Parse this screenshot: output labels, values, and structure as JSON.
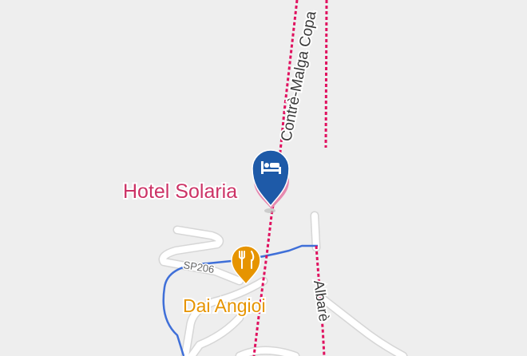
{
  "map": {
    "colors": {
      "background": "#eeeeee",
      "road": "#ffffff",
      "road_edge": "#d4d4d4",
      "trail": "#e0115f",
      "route_blue": "#3f6fd8",
      "hotel_text": "#cc3366",
      "hotel_pin": "#1e5aa8",
      "restaurant": "#e69400"
    },
    "places": {
      "hotel": {
        "name": "Hotel Solaria",
        "icon": "bed-icon"
      },
      "restaurant": {
        "name": "Dai Angioi",
        "icon": "fork-knife-icon"
      }
    },
    "roads": {
      "contre_malga": "Contrè-Malga Copa",
      "albare": "Albarè",
      "sp206": "SP206"
    }
  }
}
